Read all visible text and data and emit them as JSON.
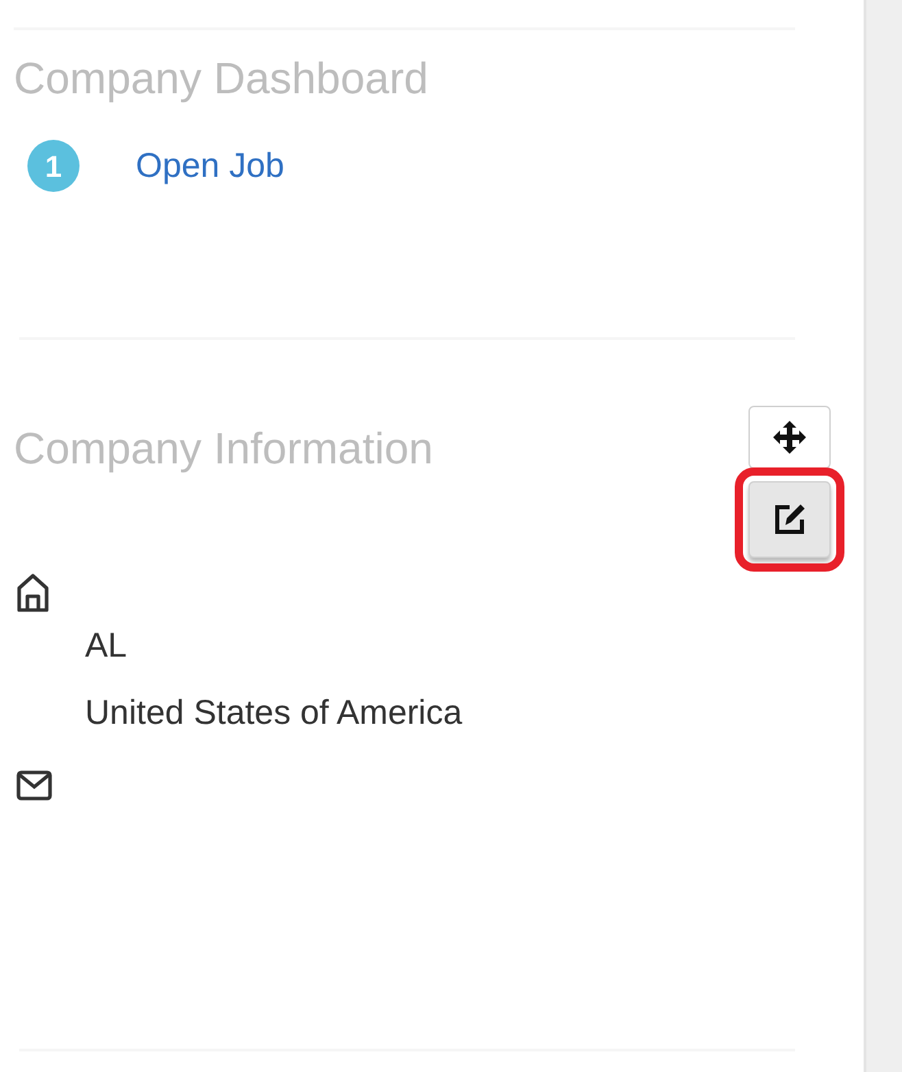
{
  "dashboard": {
    "title": "Company Dashboard",
    "items": [
      {
        "count": "1",
        "label": "Open Job"
      }
    ]
  },
  "information": {
    "title": "Company Information",
    "tools": [
      {
        "kind": "move",
        "highlighted": false
      },
      {
        "kind": "edit",
        "highlighted": true
      }
    ],
    "address_lines": [
      "AL",
      "United States of America"
    ]
  }
}
